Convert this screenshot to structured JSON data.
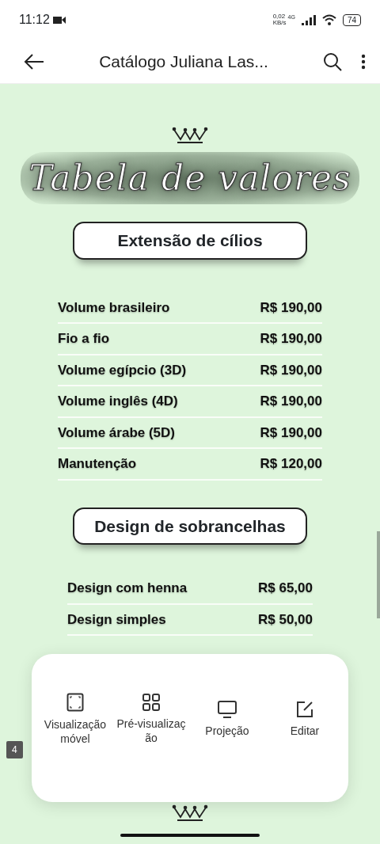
{
  "status_bar": {
    "time": "11:12",
    "data_rate": "0,02",
    "data_unit": "KB/s",
    "network": "4G",
    "battery": "74"
  },
  "app_bar": {
    "title": "Catálogo Juliana Las..."
  },
  "document": {
    "title": "Tabela de valores",
    "sections": [
      {
        "heading": "Extensão de cílios",
        "items": [
          {
            "name": "Volume brasileiro",
            "price": "R$ 190,00"
          },
          {
            "name": "Fio a fio",
            "price": "R$ 190,00"
          },
          {
            "name": "Volume egípcio (3D)",
            "price": "R$ 190,00"
          },
          {
            "name": "Volume inglês (4D)",
            "price": "R$ 190,00"
          },
          {
            "name": "Volume árabe (5D)",
            "price": "R$ 190,00"
          },
          {
            "name": "Manutenção",
            "price": "R$ 120,00"
          }
        ]
      },
      {
        "heading": "Design de sobrancelhas",
        "items": [
          {
            "name": "Design com henna",
            "price": "R$ 65,00"
          },
          {
            "name": "Design simples",
            "price": "R$ 50,00"
          }
        ]
      }
    ]
  },
  "page_badge": "4",
  "action_menu": [
    {
      "kind": "mobile",
      "label": "Visualização móvel"
    },
    {
      "kind": "grid",
      "label": "Pré-visualização"
    },
    {
      "kind": "monitor",
      "label": "Projeção"
    },
    {
      "kind": "edit",
      "label": "Editar"
    }
  ]
}
